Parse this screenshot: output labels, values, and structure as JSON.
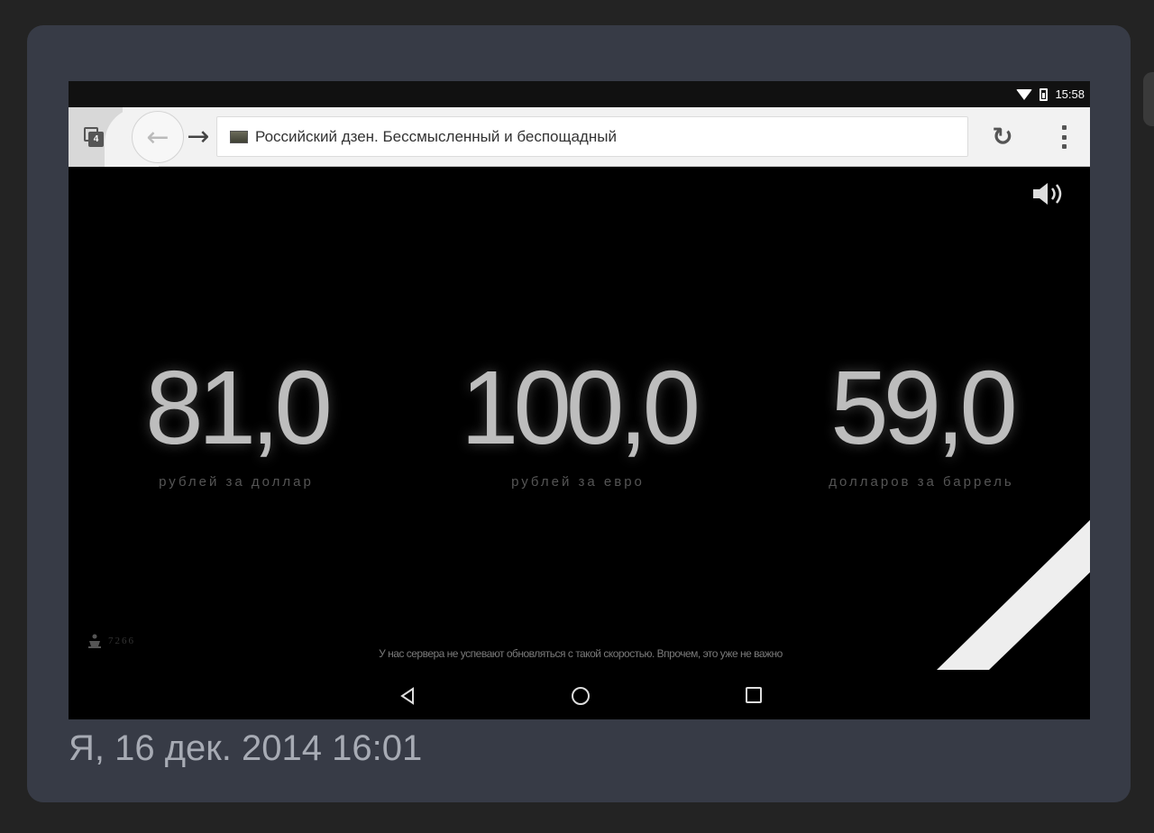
{
  "status_bar": {
    "time": "15:58",
    "icons": [
      "wifi-icon",
      "battery-icon"
    ]
  },
  "browser": {
    "tab_count": "4",
    "page_title": "Российский дзен. Бессмысленный и беспощадный",
    "icons": [
      "tabs-icon",
      "back-arrow-icon",
      "forward-arrow-icon",
      "favicon",
      "reload-icon",
      "overflow-menu-icon"
    ]
  },
  "page": {
    "rates": [
      {
        "value": "81,0",
        "caption": "рублей за доллар"
      },
      {
        "value": "100,0",
        "caption": "рублей за евро"
      },
      {
        "value": "59,0",
        "caption": "долларов за баррель"
      }
    ],
    "counter": "7266",
    "note": "У нас сервера не успевают обновляться с такой скоростью. Впрочем, это уже не важно",
    "icons": [
      "speaker-icon",
      "crown-icon"
    ]
  },
  "navbar": {
    "icons": [
      "nav-back-icon",
      "nav-home-icon",
      "nav-recents-icon"
    ]
  },
  "message": {
    "timestamp": "Я, 16 дек. 2014 16:01"
  },
  "colors": {
    "card_bg": "#373b46",
    "page_bg": "#232323",
    "number_text": "#bdbdbd",
    "timestamp_text": "#a7abb4"
  }
}
